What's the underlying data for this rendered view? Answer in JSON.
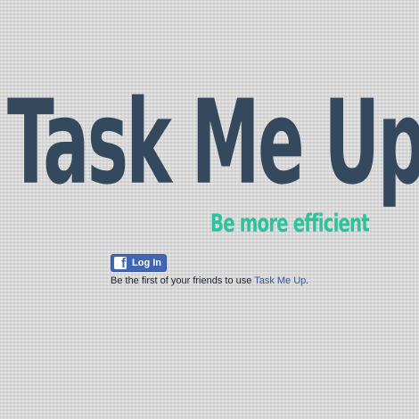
{
  "header": {
    "title": "Task Me Up",
    "tagline": "Be more efficient"
  },
  "facebook": {
    "icon": "facebook-icon",
    "icon_glyph": "f",
    "login_label": "Log In",
    "social_prefix": "Be the first of your friends to use ",
    "app_link": "Task Me Up",
    "social_suffix": "."
  },
  "colors": {
    "background": "#d8d8d8",
    "title": "#35495e",
    "tagline": "#2cc29a",
    "facebook_blue": "#4267b2",
    "link": "#365899"
  }
}
